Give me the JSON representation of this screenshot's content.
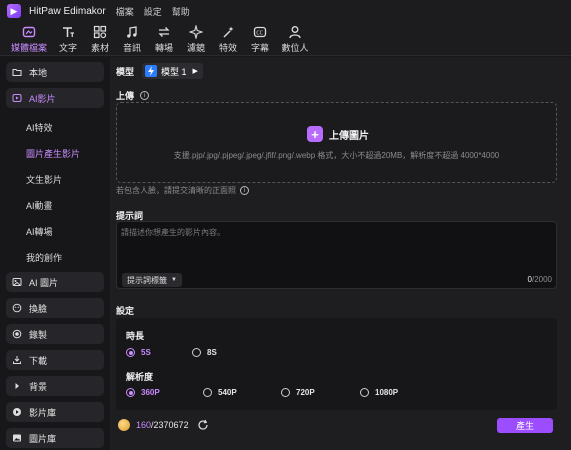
{
  "app": {
    "title": "HitPaw Edimakor"
  },
  "menu": [
    "檔案",
    "設定",
    "幫助"
  ],
  "toolbar": [
    {
      "label": "媒體檔案",
      "icon": "media-icon",
      "active": true
    },
    {
      "label": "文字",
      "icon": "text-icon"
    },
    {
      "label": "素材",
      "icon": "assets-icon"
    },
    {
      "label": "音訊",
      "icon": "audio-icon"
    },
    {
      "label": "轉場",
      "icon": "transition-icon"
    },
    {
      "label": "濾鏡",
      "icon": "filter-icon"
    },
    {
      "label": "特效",
      "icon": "effects-icon"
    },
    {
      "label": "字幕",
      "icon": "subtitle-icon"
    },
    {
      "label": "數位人",
      "icon": "avatar-icon"
    }
  ],
  "sidebar": {
    "local": "本地",
    "ai_video": "AI影片",
    "sub": [
      "AI特效",
      "圖片產生影片",
      "文生影片",
      "AI動畫",
      "AI轉場",
      "我的創作"
    ],
    "ai_image": "AI 圖片",
    "face_swap": "換臉",
    "record": "錄製",
    "download": "下載",
    "background": "背景",
    "video_library": "影片庫",
    "image_library": "圖片庫"
  },
  "model": {
    "label": "模型",
    "value": "模型 1"
  },
  "upload": {
    "label": "上傳",
    "button": "上傳圖片",
    "formats": "支援.pjp/.jpg/.pjpeg/.jpeg/.jfif/.png/.webp 格式，大小不超過20MB，解析度不超過 4000*4000",
    "face_note": "若包含人臉，請提交清晰的正面照"
  },
  "prompt": {
    "label": "提示詞",
    "placeholder": "請描述你想產生的影片內容。",
    "tag_button": "提示詞標籤",
    "count_used": "0",
    "count_max": "/2000"
  },
  "settings": {
    "label": "設定",
    "duration_label": "時長",
    "duration_options": [
      "5S",
      "8S"
    ],
    "duration_selected": "5S",
    "resolution_label": "解析度",
    "resolution_options": [
      "360P",
      "540P",
      "720P",
      "1080P"
    ],
    "resolution_selected": "360P"
  },
  "footer": {
    "credits_used": "160",
    "credits_total": "/2370672",
    "generate": "產生"
  },
  "colors": {
    "accent": "#c98cff",
    "button": "#9b4dff"
  }
}
